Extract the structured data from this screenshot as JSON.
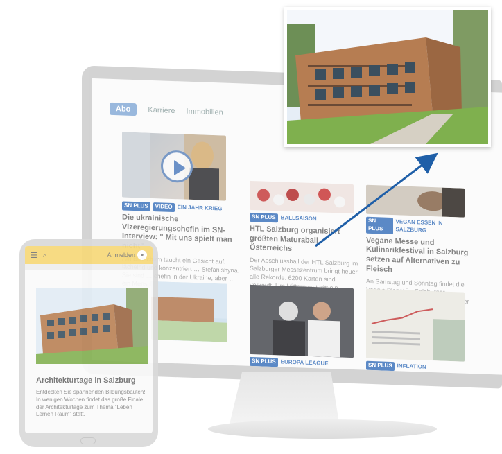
{
  "monitor": {
    "nav": {
      "abo": "Abo",
      "karriere": "Karriere",
      "immobilien": "Immobilien"
    },
    "articles": [
      {
        "plus": "SN PLUS",
        "tag": "VIDEO",
        "category": "EIN JAHR KRIEG",
        "headline": "Die ukrainische Vizeregierungschefin im SN-Interview: \" Mit uns spielt man nicht\"",
        "teaser": "Am Bildschirm taucht ein Gesicht auf: lächelnd und konzentriert … Stefanishyna. Sie sind … chefin in der Ukraine, aber … ein Mensch, eine Mutter…"
      },
      {
        "plus": "SN PLUS",
        "category": "BALLSAISON",
        "headline": "HTL Salzburg organisiert größten Maturaball Österreichs",
        "teaser": "Der Abschlussball der HTL Salzburg im Salzburger Messezentrum bringt heuer alle Rekorde. 6200 Karten sind verkauft. Um Mitternacht tritt ein Roboter in Aktion. Gäste reisen aus ganz Österreich an."
      },
      {
        "plus": "SN PLUS",
        "category": "VEGAN ESSEN IN SALZBURG",
        "headline": "Vegane Messe und Kulinarikfestival in Salzburg setzen auf Alternativen zu Fleisch",
        "teaser": "An Samstag und Sonntag findet die Veggie Planet im Salzburger Messezentrum statt. Der Veranstalter rechnet mit einem neuen Besucherrekord. Auch das Altstadt-Kulinarikfestival extämeet widmet sich i…"
      },
      {
        "plus": "SN PLUS",
        "category": "EUROPA LEAGUE"
      },
      {
        "plus": "SN PLUS",
        "category": "INFLATION"
      }
    ]
  },
  "tablet": {
    "login": "Anmelden",
    "title": "Architekturtage in Salzburg",
    "teaser": "Entdecken Sie spannenden Bildungsbauten! In wenigen Wochen findet das große Finale der Architekturtage zum Thema \"Leben Lernen Raum\" statt."
  },
  "colors": {
    "accent": "#4a7dc0",
    "tablet_header": "#f7d979",
    "arrow": "#1f5fa8"
  }
}
